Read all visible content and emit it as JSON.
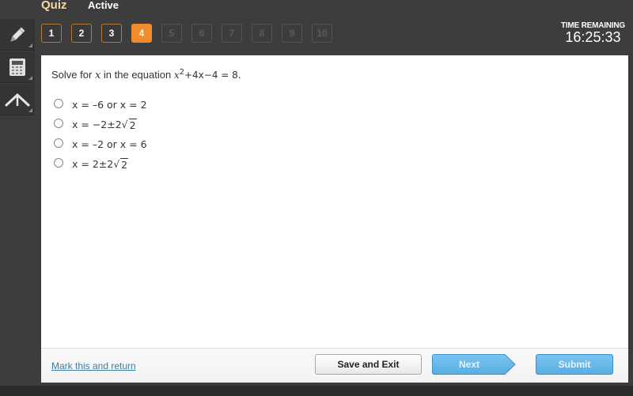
{
  "header": {
    "title": "Quiz",
    "status": "Active"
  },
  "question_nav": [
    {
      "label": "1",
      "state": "done"
    },
    {
      "label": "2",
      "state": "done"
    },
    {
      "label": "3",
      "state": "done"
    },
    {
      "label": "4",
      "state": "current"
    },
    {
      "label": "5",
      "state": "todo"
    },
    {
      "label": "6",
      "state": "todo"
    },
    {
      "label": "7",
      "state": "todo"
    },
    {
      "label": "8",
      "state": "todo"
    },
    {
      "label": "9",
      "state": "todo"
    },
    {
      "label": "10",
      "state": "todo"
    }
  ],
  "timer": {
    "label": "TIME REMAINING",
    "value": "16:25:33"
  },
  "tools": [
    {
      "icon": "pencil-icon"
    },
    {
      "icon": "calculator-icon"
    },
    {
      "icon": "reference-arrow-icon"
    }
  ],
  "question": {
    "prefix": "Solve for",
    "variable": "x",
    "middle": "in the equation",
    "equation_base": "x",
    "equation_exp": "2",
    "equation_rest": "+4x−4 = 8",
    "end": "."
  },
  "options": [
    {
      "pre": "x = –6 or x = 2",
      "radical": ""
    },
    {
      "pre": "x = −2±2",
      "radical": "2"
    },
    {
      "pre": "x = –2 or x = 6",
      "radical": ""
    },
    {
      "pre": "x = 2±2",
      "radical": "2"
    }
  ],
  "footer": {
    "mark_link": "Mark this and return",
    "save_exit": "Save and Exit",
    "next": "Next",
    "submit": "Submit"
  },
  "colors": {
    "accent_orange": "#f08c2a",
    "button_blue": "#5aafe3",
    "link_blue": "#3b7ea6"
  }
}
